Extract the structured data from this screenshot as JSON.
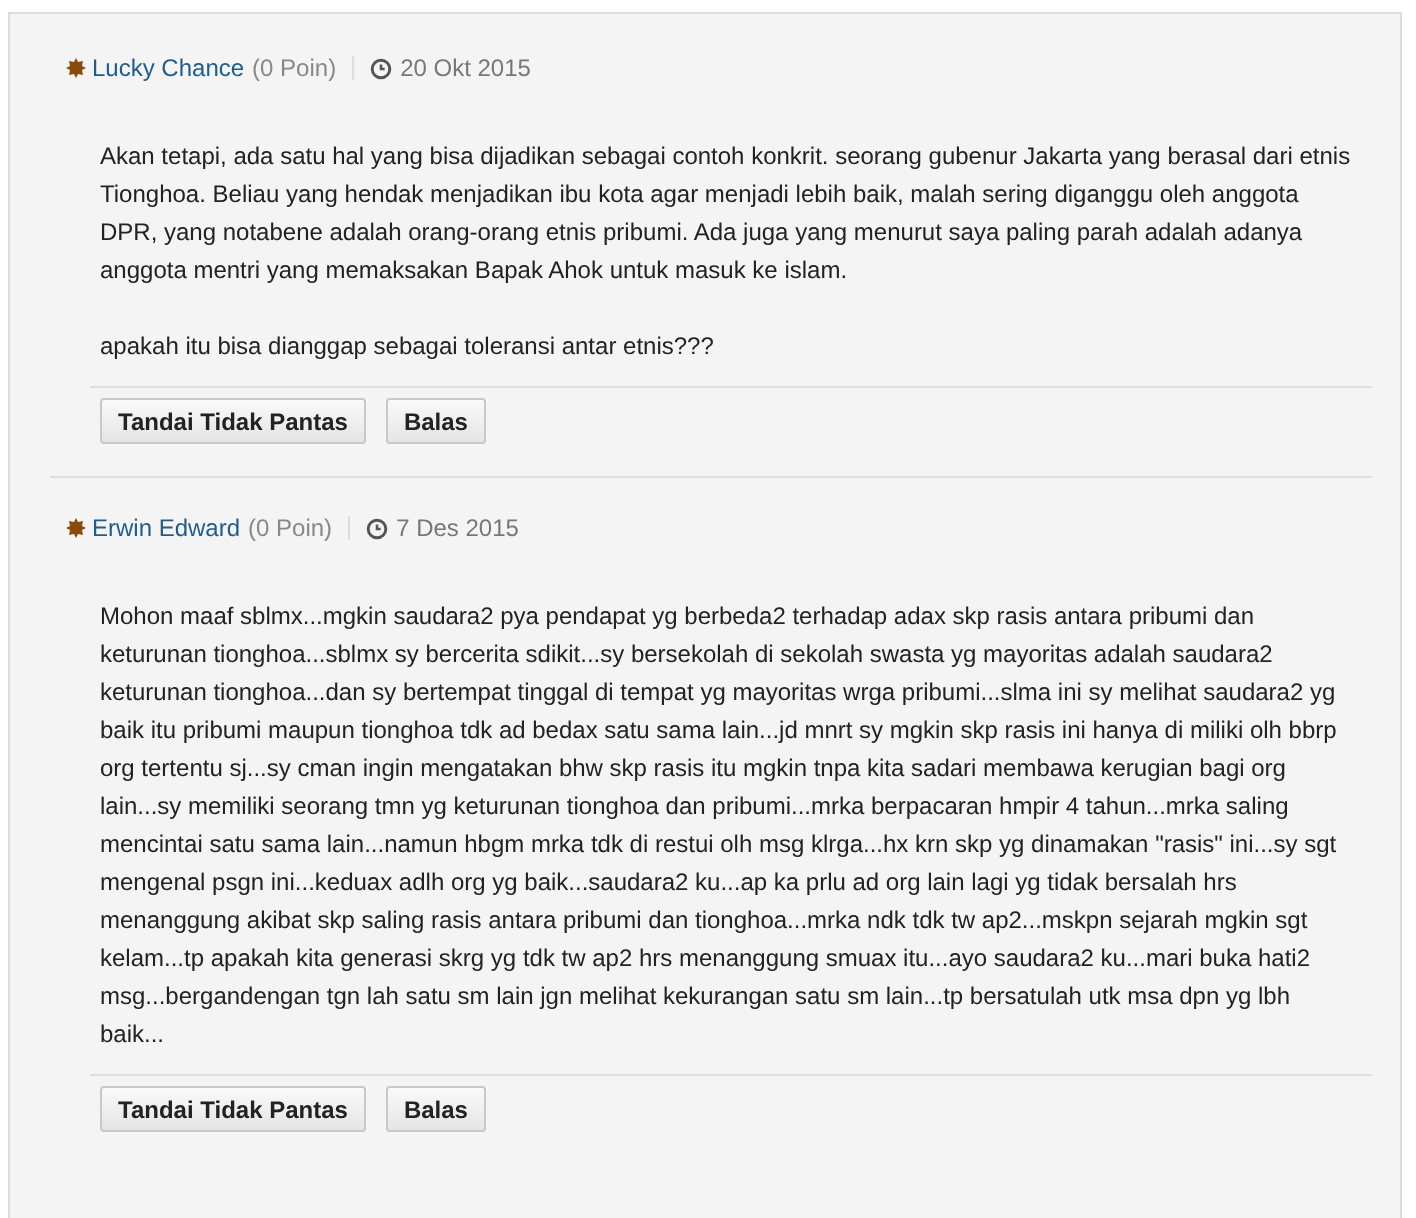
{
  "posts": [
    {
      "author": "Lucky Chance",
      "points": "(0 Poin)",
      "date": "20 Okt 2015",
      "paragraphs": [
        "Akan tetapi, ada satu hal yang bisa dijadikan sebagai contoh konkrit. seorang gubenur Jakarta yang berasal dari etnis Tionghoa. Beliau yang hendak menjadikan ibu kota agar menjadi lebih baik, malah sering diganggu oleh anggota DPR, yang notabene adalah orang-orang etnis pribumi. Ada juga yang menurut saya paling parah adalah adanya anggota mentri yang memaksakan  Bapak Ahok untuk masuk ke islam.",
        "apakah itu bisa dianggap sebagai toleransi antar etnis???"
      ],
      "buttons": [
        "Tandai Tidak Pantas",
        "Balas"
      ]
    },
    {
      "author": "Erwin Edward",
      "points": "(0 Poin)",
      "date": "7 Des 2015",
      "paragraphs": [
        "Mohon maaf sblmx...mgkin saudara2 pya pendapat yg berbeda2 terhadap adax skp rasis antara pribumi dan keturunan tionghoa...sblmx sy bercerita sdikit...sy bersekolah di sekolah swasta yg mayoritas adalah saudara2 keturunan tionghoa...dan sy bertempat tinggal di tempat yg mayoritas wrga pribumi...slma ini sy melihat saudara2 yg baik itu pribumi maupun tionghoa tdk ad bedax satu sama lain...jd mnrt sy mgkin skp rasis ini hanya di miliki olh bbrp org tertentu sj...sy cman ingin mengatakan bhw skp rasis itu mgkin tnpa kita sadari membawa kerugian bagi org lain...sy memiliki seorang tmn yg keturunan tionghoa dan pribumi...mrka berpacaran hmpir 4 tahun...mrka saling mencintai satu sama lain...namun hbgm mrka tdk di restui olh msg klrga...hx krn skp yg dinamakan \"rasis\" ini...sy sgt mengenal psgn ini...keduax adlh org yg baik...saudara2 ku...ap ka prlu ad org lain lagi yg tidak bersalah hrs menanggung akibat skp saling rasis antara pribumi dan tionghoa...mrka ndk tdk tw ap2...mskpn sejarah mgkin sgt kelam...tp apakah kita generasi skrg yg tdk tw ap2 hrs menanggung smuax itu...ayo saudara2 ku...mari buka hati2 msg...bergandengan tgn lah satu sm lain jgn melihat kekurangan satu sm lain...tp bersatulah utk msa dpn yg lbh baik..."
      ],
      "buttons": [
        "Tandai Tidak Pantas",
        "Balas"
      ]
    }
  ]
}
